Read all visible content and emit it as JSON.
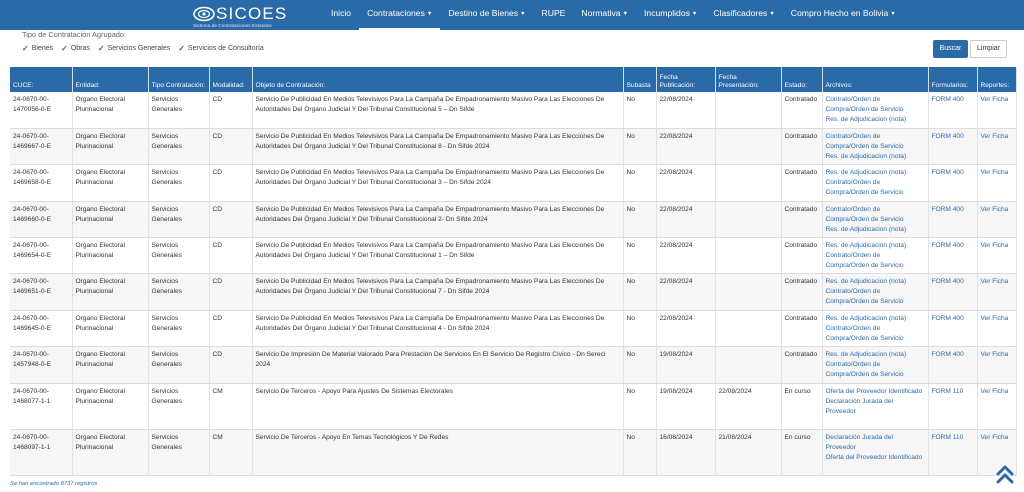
{
  "brand": {
    "name": "SICOES",
    "subtitle": "Sistema de Contrataciones Estatales"
  },
  "nav": [
    {
      "label": "Inicio",
      "dropdown": false,
      "active": false
    },
    {
      "label": "Contrataciones",
      "dropdown": true,
      "active": true
    },
    {
      "label": "Destino de Bienes",
      "dropdown": true,
      "active": false
    },
    {
      "label": "RUPE",
      "dropdown": false,
      "active": false
    },
    {
      "label": "Normativa",
      "dropdown": true,
      "active": false
    },
    {
      "label": "Incumplidos",
      "dropdown": true,
      "active": false
    },
    {
      "label": "Clasificadores",
      "dropdown": true,
      "active": false
    },
    {
      "label": "Compro Hecho en Bolivia",
      "dropdown": true,
      "active": false
    }
  ],
  "filter": {
    "label": "Tipo de Contratación Agrupado:",
    "options": [
      "Bienes",
      "Obras",
      "Servicios Generales",
      "Servicios de Consultoría"
    ],
    "search_label": "Buscar",
    "clear_label": "Limpiar"
  },
  "table": {
    "columns": [
      "CUCE:",
      "Entidad:",
      "Tipo Contratación:",
      "Modalidad:",
      "Objeto de Contratación:",
      "Subasta",
      "Fecha Publicación:",
      "Fecha Presentación:",
      "Estado:",
      "Archivos:",
      "Formularios:",
      "Reportes:"
    ],
    "rows": [
      {
        "cuce": "24-0670-00-1470056-0-E",
        "entidad": "Organo Electoral Plurinacional",
        "tipo": "Servicios Generales",
        "modalidad": "CD",
        "objeto": "Servicio De Publicidad En Medios Televisivos Para La Campaña De Empadronamiento Masivo Para Las Elecciones De Autoridades Del Órgano Judicial Y Del Tribunal Constitucional 5 – Dn Sifde",
        "subasta": "No",
        "publicacion": "22/08/2024",
        "presentacion": "",
        "estado": "Contratado",
        "archivos": [
          "Contrato/Orden de Compra/Orden de Servicio",
          "Res. de Adjudicacion (nota)"
        ],
        "formulario": "FORM 400",
        "reporte": "Ver Ficha"
      },
      {
        "cuce": "24-0670-00-1469667-0-E",
        "entidad": "Organo Electoral Plurinacional",
        "tipo": "Servicios Generales",
        "modalidad": "CD",
        "objeto": "Servicio De Publicidad En Medios Televisivos Para La Campaña De Empadronamiento Masivo Para Las Elecciones De Autoridades Del Órgano Judicial Y Del Tribunal Constitucional 8 - Dn Sifde 2024",
        "subasta": "No",
        "publicacion": "22/08/2024",
        "presentacion": "",
        "estado": "Contratado",
        "archivos": [
          "Contrato/Orden de Compra/Orden de Servicio",
          "Res. de Adjudicacion (nota)"
        ],
        "formulario": "FORM 400",
        "reporte": "Ver Ficha"
      },
      {
        "cuce": "24-0670-00-1469658-0-E",
        "entidad": "Organo Electoral Plurinacional",
        "tipo": "Servicios Generales",
        "modalidad": "CD",
        "objeto": "Servicio De Publicidad En Medios Televisivos Para La Campaña De Empadronamiento Masivo Para Las Elecciones De Autoridades Del Órgano Judicial Y Del Tribunal Constitucional 3 – Dn Sifde 2024",
        "subasta": "No",
        "publicacion": "22/08/2024",
        "presentacion": "",
        "estado": "Contratado",
        "archivos": [
          "Res. de Adjudicacion (nota)",
          "Contrato/Orden de Compra/Orden de Servicio"
        ],
        "formulario": "FORM 400",
        "reporte": "Ver Ficha"
      },
      {
        "cuce": "24-0670-00-1469660-0-E",
        "entidad": "Organo Electoral Plurinacional",
        "tipo": "Servicios Generales",
        "modalidad": "CD",
        "objeto": "Servicio De Publicidad En Medios Televisivos Para La Campaña De Empadronamiento Masivo Para Las Elecciones De Autoridades Del Órgano Judicial Y Del Tribunal Constitucional 2- Dn Sifde 2024",
        "subasta": "No",
        "publicacion": "22/08/2024",
        "presentacion": "",
        "estado": "Contratado",
        "archivos": [
          "Contrato/Orden de Compra/Orden de Servicio",
          "Res. de Adjudicacion (nota)"
        ],
        "formulario": "FORM 400",
        "reporte": "Ver Ficha"
      },
      {
        "cuce": "24-0670-00-1469654-0-E",
        "entidad": "Organo Electoral Plurinacional",
        "tipo": "Servicios Generales",
        "modalidad": "CD",
        "objeto": "Servicio De Publicidad En Medios Televisivos Para La Campaña De Empadronamiento Masivo Para Las Elecciones De Autoridades Del Órgano Judicial Y Del Tribunal Constitucional 1 – Dn Sifde",
        "subasta": "No",
        "publicacion": "22/08/2024",
        "presentacion": "",
        "estado": "Contratado",
        "archivos": [
          "Res. de Adjudicacion (nota)",
          "Contrato/Orden de Compra/Orden de Servicio"
        ],
        "formulario": "FORM 400",
        "reporte": "Ver Ficha"
      },
      {
        "cuce": "24-0670-00-1469651-0-E",
        "entidad": "Organo Electoral Plurinacional",
        "tipo": "Servicios Generales",
        "modalidad": "CD",
        "objeto": "Servicio De Publicidad En Medios Televisivos Para La Campaña De Empadronamiento Masivo Para Las Elecciones De Autoridades Del Órgano Judicial Y Del Tribunal Constitucional 7 - Dn Sifde 2024",
        "subasta": "No",
        "publicacion": "22/08/2024",
        "presentacion": "",
        "estado": "Contratado",
        "archivos": [
          "Res. de Adjudicacion (nota)",
          "Contrato/Orden de Compra/Orden de Servicio"
        ],
        "formulario": "FORM 400",
        "reporte": "Ver Ficha"
      },
      {
        "cuce": "24-0670-00-1469645-0-E",
        "entidad": "Organo Electoral Plurinacional",
        "tipo": "Servicios Generales",
        "modalidad": "CD",
        "objeto": "Servicio De Publicidad En Medios Televisivos Para La Campaña De Empadronamiento Masivo Para Las Elecciones De Autoridades Del Órgano Judicial Y Del Tribunal Constitucional 4 - Dn Sifde 2024",
        "subasta": "No",
        "publicacion": "22/08/2024",
        "presentacion": "",
        "estado": "Contratado",
        "archivos": [
          "Res. de Adjudicacion (nota)",
          "Contrato/Orden de Compra/Orden de Servicio"
        ],
        "formulario": "FORM 400",
        "reporte": "Ver Ficha"
      },
      {
        "cuce": "24-0670-00-1457948-0-E",
        "entidad": "Organo Electoral Plurinacional",
        "tipo": "Servicios Generales",
        "modalidad": "CD",
        "objeto": "Servicio De Impresión De Material Valorado Para Prestación De Servicios En El Servicio De Registro Cívico - Dn Sereci 2024",
        "subasta": "No",
        "publicacion": "19/08/2024",
        "presentacion": "",
        "estado": "Contratado",
        "archivos": [
          "Res. de Adjudicacion (nota)",
          "Contrato/Orden de Compra/Orden de Servicio"
        ],
        "formulario": "FORM 400",
        "reporte": "Ver Ficha"
      },
      {
        "cuce": "24-0670-00-1468077-1-1",
        "entidad": "Organo Electoral Plurinacional",
        "tipo": "Servicios Generales",
        "modalidad": "CM",
        "objeto": "Servicio De Terceros - Apoyo Para Ajustes De Sistemas Electorales",
        "subasta": "No",
        "publicacion": "19/08/2024",
        "presentacion": "22/08/2024",
        "estado": "En curso",
        "archivos": [
          "Oferta del Proveedor Identificado",
          "Declaración Jurada del Proveedor"
        ],
        "formulario": "FORM 110",
        "reporte": "Ver Ficha"
      },
      {
        "cuce": "24-0670-00-1468097-1-1",
        "entidad": "Organo Electoral Plurinacional",
        "tipo": "Servicios Generales",
        "modalidad": "CM",
        "objeto": "Servicio De Terceros - Apoyo En Temas Tecnológicos Y De Redes",
        "subasta": "No",
        "publicacion": "16/08/2024",
        "presentacion": "21/08/2024",
        "estado": "En curso",
        "archivos": [
          "Declaración Jurada del Proveedor",
          "Oferta del Proveedor Identificado"
        ],
        "formulario": "FORM 110",
        "reporte": "Ver Ficha"
      }
    ]
  },
  "footer": {
    "records_text": "Se han encontrado 8737 registros"
  },
  "colors": {
    "primary": "#2b6aa8",
    "link": "#2b6aa8"
  },
  "icons": {
    "logo": "sicoes-logo-icon",
    "check": "check-icon",
    "scroll_top": "double-chevron-up-icon"
  }
}
